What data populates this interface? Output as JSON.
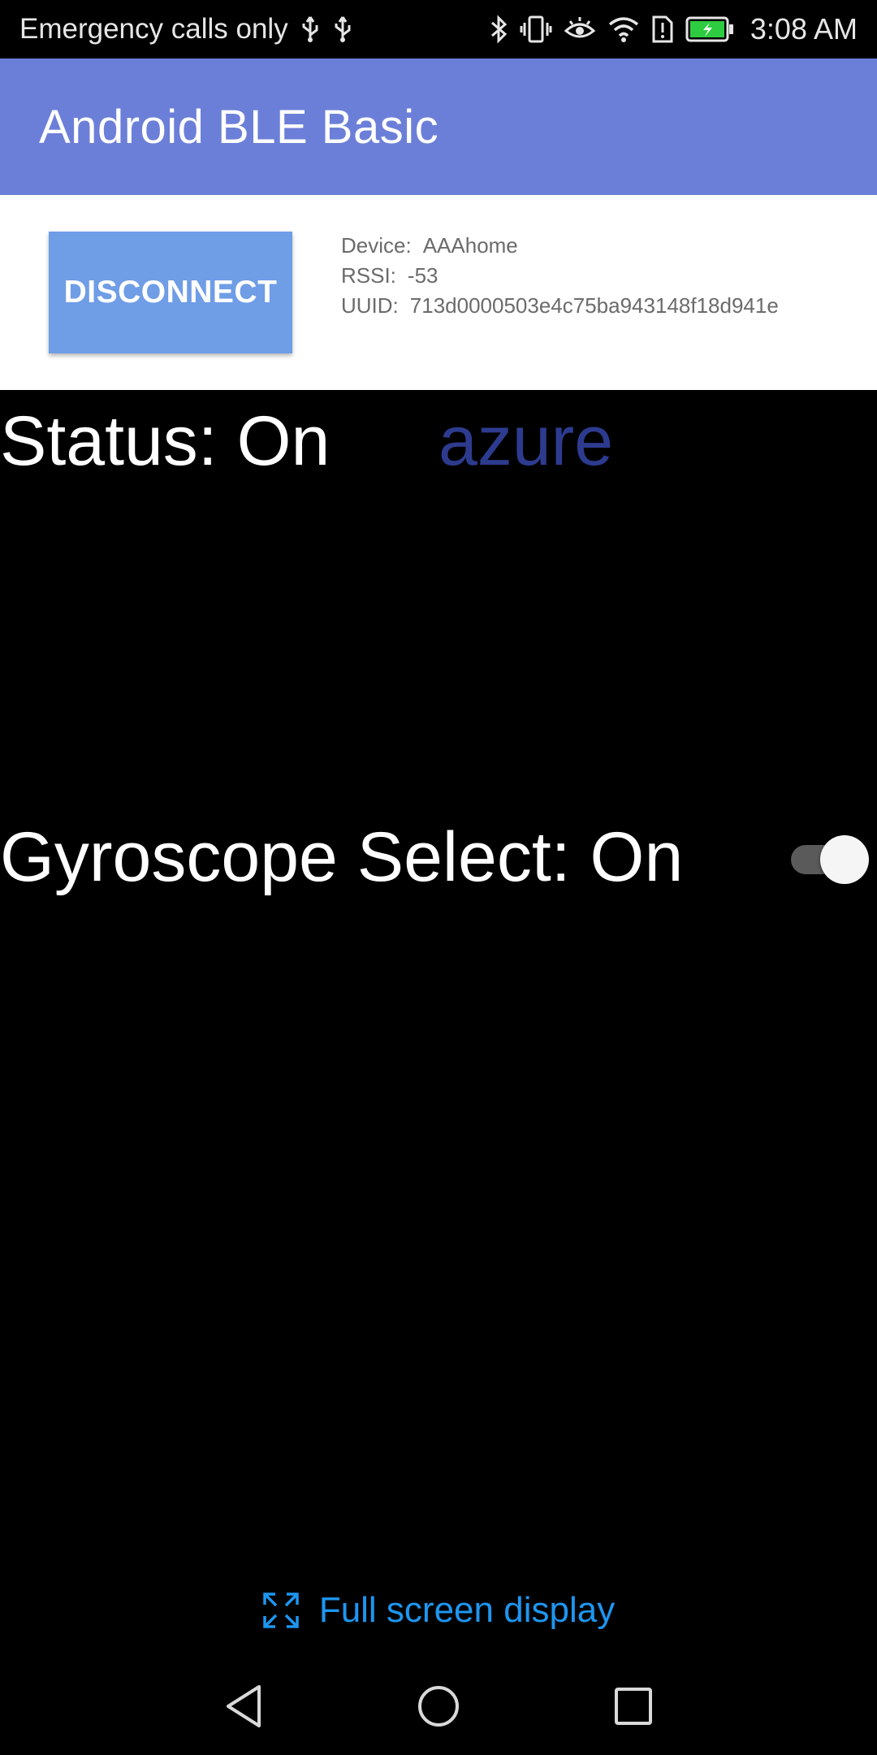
{
  "status_bar": {
    "carrier_text": "Emergency calls only",
    "time": "3:08 AM",
    "icons": [
      "usb-icon",
      "usb-icon",
      "bluetooth-icon",
      "vibrate-icon",
      "eye-comfort-icon",
      "wifi-icon",
      "no-sim-icon",
      "battery-charging-icon"
    ],
    "battery_color": "#2ecc40"
  },
  "app_bar": {
    "title": "Android BLE Basic",
    "color": "#6c7fd8"
  },
  "device_card": {
    "disconnect_label": "DISCONNECT",
    "device_label": "Device:",
    "device_value": "AAAhome",
    "rssi_label": "RSSI:",
    "rssi_value": "-53",
    "uuid_label": "UUID:",
    "uuid_value": "713d0000503e4c75ba943148f18d941e"
  },
  "main": {
    "status_text": "Status: On",
    "color_name": "azure",
    "color_name_color": "#2d3b8f",
    "gyro_label": "Gyroscope Select: On",
    "gyro_switch_on": true
  },
  "footer": {
    "fullscreen_label": "Full screen display",
    "link_color": "#1e96f0"
  },
  "nav_bar": {
    "buttons": [
      "back-icon",
      "home-icon",
      "recents-icon"
    ]
  }
}
